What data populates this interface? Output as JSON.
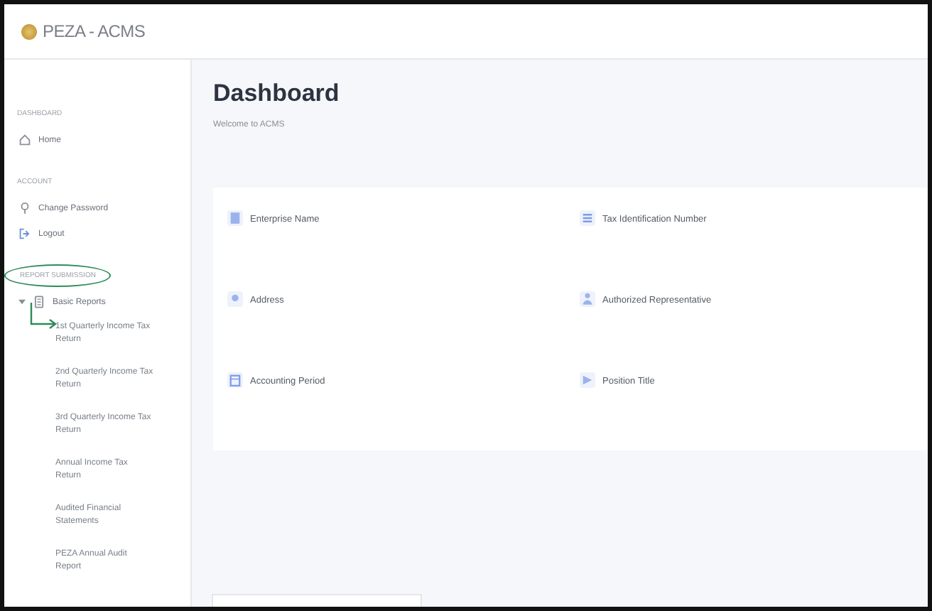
{
  "header": {
    "title": "PEZA - ACMS"
  },
  "sidebar": {
    "sections": [
      {
        "label": "DASHBOARD",
        "highlighted": false,
        "items": [
          {
            "kind": "home",
            "label": "Home"
          }
        ]
      },
      {
        "label": "ACCOUNT",
        "highlighted": false,
        "items": [
          {
            "kind": "key",
            "label": "Change Password"
          },
          {
            "kind": "logout",
            "label": "Logout"
          }
        ]
      },
      {
        "label": "REPORT SUBMISSION",
        "highlighted": true,
        "items": [
          {
            "kind": "folder",
            "label": "Basic Reports",
            "expanded": true,
            "children": [
              {
                "label": "1st Quarterly Income Tax Return",
                "annotated": true
              },
              {
                "label": "2nd Quarterly Income Tax Return",
                "annotated": false
              },
              {
                "label": "3rd Quarterly Income Tax Return",
                "annotated": false
              },
              {
                "label": "Annual Income Tax Return",
                "annotated": false
              },
              {
                "label": "Audited Financial Statements",
                "annotated": false
              },
              {
                "label": "PEZA Annual Audit Report",
                "annotated": false
              }
            ]
          }
        ]
      }
    ]
  },
  "main": {
    "title": "Dashboard",
    "subtitle": "Welcome to ACMS",
    "fields": [
      {
        "kind": "building",
        "label": "Enterprise Name"
      },
      {
        "kind": "list",
        "label": "Tax Identification Number"
      },
      {
        "kind": "pin",
        "label": "Address"
      },
      {
        "kind": "person",
        "label": "Authorized Representative"
      },
      {
        "kind": "calendar",
        "label": "Accounting Period"
      },
      {
        "kind": "badge",
        "label": "Position Title"
      }
    ]
  }
}
